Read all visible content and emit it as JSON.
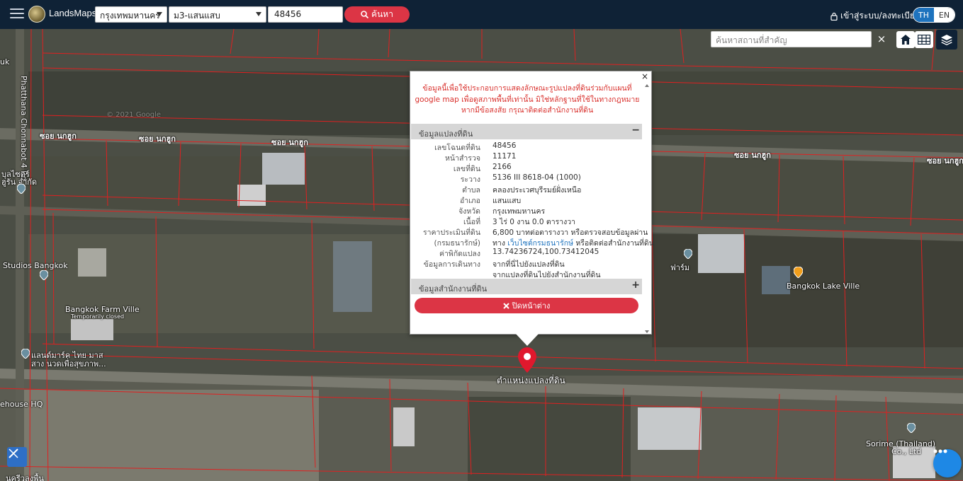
{
  "app": {
    "brand": "LandsMaps"
  },
  "topbar": {
    "province": "กรุงเทพมหานคร",
    "district": "ม3-แสนแสบ",
    "parcel_no": "48456",
    "search_label": "ค้นหา",
    "login_label": "เข้าสู่ระบบ/ลงทะเบียน",
    "lang_th": "TH",
    "lang_en": "EN"
  },
  "map_controls": {
    "place_search_placeholder": "ค้นหาสถานที่สำคัญ",
    "clear_symbol": "×"
  },
  "popup": {
    "close_symbol": "×",
    "notice": "ข้อมูลนี้เพื่อใช้ประกอบการแสดงลักษณะรูปแปลงที่ดินร่วมกับแผนที่ google map เพื่อดูสภาพพื้นที่เท่านั้น มิใช่หลักฐานที่ใช้ในทางกฎหมาย หากมีข้อสงสัย กรุณาติดต่อสำนักงานที่ดิน",
    "section1_title": "ข้อมูลแปลงที่ดิน",
    "section1_symbol": "−",
    "section2_title": "ข้อมูลสำนักงานที่ดิน",
    "section2_symbol": "+",
    "fields": {
      "deed_no_label": "เลขโฉนดที่ดิน",
      "deed_no": "48456",
      "survey_page_label": "หน้าสำรวจ",
      "survey_page": "11171",
      "land_no_label": "เลขที่ดิน",
      "land_no": "2166",
      "sheet_label": "ระวาง",
      "sheet": "5136 III 8618-04 (1000)",
      "subdistrict_label": "ตำบล",
      "subdistrict": "คลองประเวศบุรีรมย์ฝั่งเหนือ",
      "district_label": "อำเภอ",
      "district": "แสนแสบ",
      "province_label": "จังหวัด",
      "province": "กรุงเทพมหานคร",
      "area_label": "เนื้อที่",
      "area": "3 ไร่ 0 งาน 0.0 ตารางวา",
      "price_label": "ราคาประเมินที่ดิน",
      "price": "6,800 บาทต่อตารางวา หรือตรวจสอบข้อมูลผ่าน",
      "price_label2": "(กรมธนารักษ์)",
      "price_pre": "ทาง",
      "price_link": "เว็บไซต์กรมธนารักษ์",
      "price_post": "หรือติดต่อสำนักงานที่ดิน",
      "coord_label": "ค่าพิกัดแปลง",
      "coord": "13.74236724,100.73412045",
      "travel_label": "ข้อมูลการเดินทาง",
      "travel_link1": "จากที่นี่ไปยังแปลงที่ดิน",
      "travel_link2": "จากแปลงที่ดินไปยังสำนักงานที่ดิน"
    },
    "close_button": "ปิดหน้าต่าง"
  },
  "map_labels": {
    "road_vertical": "Phatthana Chonnabot 4 Rd",
    "soi1": "ซอย นกฮูก",
    "soi2": "ซอย นกฮูก",
    "soi3": "ซอย นกฮูก",
    "soi4": "ซอย นกฮูก",
    "soi5": "ซอย นกฮูก",
    "google_watermark": "© 2021 Google",
    "place_studios": "Studios Bangkok",
    "place_farm": "Bangkok Farm Ville",
    "place_farm_status": "Temporarily closed",
    "place_lake": "Bangkok Lake Ville",
    "place_sorime1": "Sorime (Thailand)",
    "place_sorime2": "Co., Ltd",
    "place_warehouse": "ehouse HQ",
    "place_left1": "แลนด์มาร์ค ไทย มาส",
    "place_left2": "สาง นวดเพื่อสุขภาพ...",
    "place_farm_right": "ฟาร์ม",
    "place_top_left": "uk",
    "place_left_mid1": "บุลไซตร์",
    "place_left_mid2": "ฮูรัน จำกัด",
    "pin_label": "ตำแหน่งแปลงที่ดิน",
    "bottom_left": "นครีวลงพื้น"
  },
  "icons": {
    "menu": "hamburger-icon",
    "search": "search-icon",
    "lock": "lock-icon",
    "home": "home-icon",
    "grid": "grid-icon",
    "layers": "layers-icon",
    "times": "times-icon",
    "pin": "map-pin-icon",
    "more": "more-icon",
    "tool": "tool-icon"
  },
  "colors": {
    "topbar": "#0f2236",
    "accent_red": "#dc3545",
    "link_blue": "#1e73be",
    "parcel_line": "#e02020",
    "notice_red": "#d9302c"
  }
}
